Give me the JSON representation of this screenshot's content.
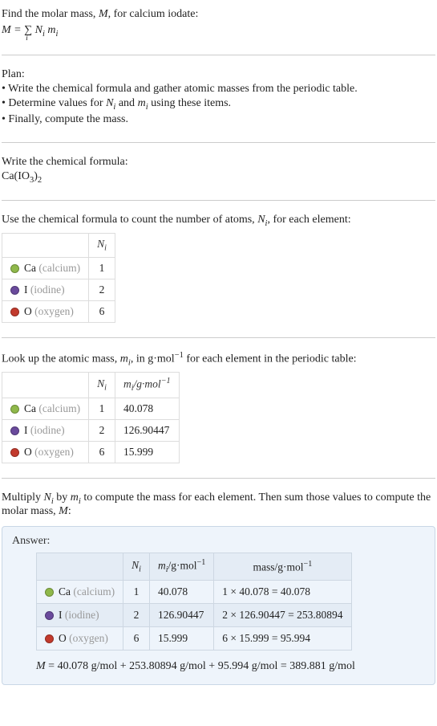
{
  "intro": {
    "line1_pre": "Find the molar mass, ",
    "line1_var": "M",
    "line1_post": ", for calcium iodate:",
    "eq_lhs": "M",
    "eq_eq": " = ",
    "eq_sum": "∑",
    "eq_sub": "i",
    "eq_rhs1": " N",
    "eq_rhs1_sub": "i",
    "eq_rhs2": " m",
    "eq_rhs2_sub": "i"
  },
  "plan": {
    "title": "Plan:",
    "b1": "• Write the chemical formula and gather atomic masses from the periodic table.",
    "b2_pre": "• Determine values for ",
    "b2_n": "N",
    "b2_nsub": "i",
    "b2_mid": " and ",
    "b2_m": "m",
    "b2_msub": "i",
    "b2_post": " using these items.",
    "b3": "• Finally, compute the mass."
  },
  "formula": {
    "title": "Write the chemical formula:",
    "base": "Ca(IO",
    "sub1": "3",
    "mid": ")",
    "sub2": "2"
  },
  "counts": {
    "intro_pre": "Use the chemical formula to count the number of atoms, ",
    "intro_n": "N",
    "intro_nsub": "i",
    "intro_post": ", for each element:",
    "hdr_n": "N",
    "hdr_nsub": "i",
    "rows": [
      {
        "sym": "Ca",
        "name": "(calcium)",
        "swatch": "sw-ca",
        "n": "1"
      },
      {
        "sym": "I",
        "name": "(iodine)",
        "swatch": "sw-i",
        "n": "2"
      },
      {
        "sym": "O",
        "name": "(oxygen)",
        "swatch": "sw-o",
        "n": "6"
      }
    ]
  },
  "masses": {
    "intro_pre": "Look up the atomic mass, ",
    "intro_m": "m",
    "intro_msub": "i",
    "intro_mid": ", in g·mol",
    "intro_sup": "−1",
    "intro_post": " for each element in the periodic table:",
    "hdr_n": "N",
    "hdr_nsub": "i",
    "hdr_m": "m",
    "hdr_msub": "i",
    "hdr_unit": "/g·mol",
    "hdr_unit_sup": "−1",
    "rows": [
      {
        "sym": "Ca",
        "name": "(calcium)",
        "swatch": "sw-ca",
        "n": "1",
        "m": "40.078"
      },
      {
        "sym": "I",
        "name": "(iodine)",
        "swatch": "sw-i",
        "n": "2",
        "m": "126.90447"
      },
      {
        "sym": "O",
        "name": "(oxygen)",
        "swatch": "sw-o",
        "n": "6",
        "m": "15.999"
      }
    ]
  },
  "compute": {
    "l1_pre": "Multiply ",
    "l1_n": "N",
    "l1_nsub": "i",
    "l1_mid": " by ",
    "l1_m": "m",
    "l1_msub": "i",
    "l1_post": " to compute the mass for each element. Then sum those values to compute the molar mass, ",
    "l1_M": "M",
    "l1_end": ":"
  },
  "answer": {
    "label": "Answer:",
    "hdr_n": "N",
    "hdr_nsub": "i",
    "hdr_m": "m",
    "hdr_msub": "i",
    "hdr_munit": "/g·mol",
    "hdr_munit_sup": "−1",
    "hdr_mass": "mass/g·mol",
    "hdr_mass_sup": "−1",
    "rows": [
      {
        "sym": "Ca",
        "name": "(calcium)",
        "swatch": "sw-ca",
        "n": "1",
        "m": "40.078",
        "mass": "1 × 40.078 = 40.078"
      },
      {
        "sym": "I",
        "name": "(iodine)",
        "swatch": "sw-i",
        "n": "2",
        "m": "126.90447",
        "mass": "2 × 126.90447 = 253.80894"
      },
      {
        "sym": "O",
        "name": "(oxygen)",
        "swatch": "sw-o",
        "n": "6",
        "m": "15.999",
        "mass": "6 × 15.999 = 95.994"
      }
    ],
    "final_lhs": "M",
    "final_rest": " = 40.078 g/mol + 253.80894 g/mol + 95.994 g/mol = 389.881 g/mol"
  }
}
